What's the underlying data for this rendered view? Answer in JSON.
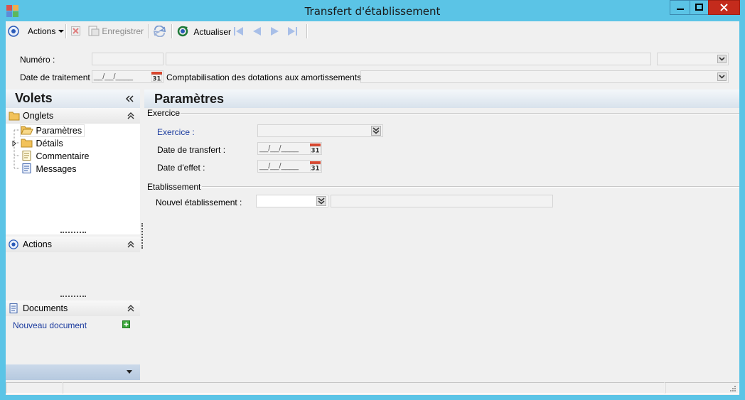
{
  "window": {
    "title": "Transfert d'établissement"
  },
  "toolbar": {
    "actions_label": "Actions",
    "save_label": "Enregistrer",
    "refresh_label": "Actualiser"
  },
  "header": {
    "numero_label": "Numéro :",
    "date_traitement_label": "Date de traitement :",
    "date_traitement_value": "__/__/____",
    "comptabilisation_label": "Comptabilisation des dotations aux amortissements :"
  },
  "volets": {
    "title": "Volets",
    "onglets": {
      "title": "Onglets",
      "items": [
        "Paramètres",
        "Détails",
        "Commentaire",
        "Messages"
      ]
    },
    "actions": {
      "title": "Actions"
    },
    "documents": {
      "title": "Documents",
      "new_document": "Nouveau document"
    }
  },
  "main": {
    "title": "Paramètres",
    "exercice_group": {
      "title": "Exercice",
      "exercice_label": "Exercice :",
      "date_transfert_label": "Date de transfert :",
      "date_transfert_value": "__/__/____",
      "date_effet_label": "Date d'effet :",
      "date_effet_value": "__/__/____"
    },
    "etablissement_group": {
      "title": "Etablissement",
      "nouvel_label": "Nouvel établissement :"
    }
  },
  "calendar_day": "31",
  "colors": {
    "window_frame": "#5bc4e6",
    "client_bg": "#f0f0f0",
    "link": "#1a3a9e",
    "close_red": "#c42b1c"
  }
}
